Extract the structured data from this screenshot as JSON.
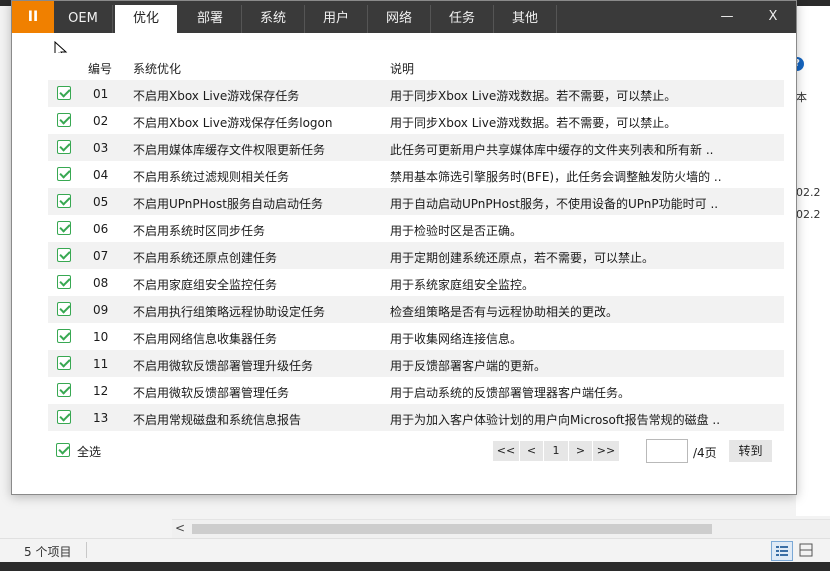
{
  "app": {
    "menu_glyph": "II",
    "tabs": [
      "OEM",
      "优化",
      "部署",
      "系统",
      "用户",
      "网络",
      "任务",
      "其他"
    ],
    "active_tab": "优化",
    "window_buttons": {
      "minimize": "—",
      "maximize": "☐",
      "close": "X"
    }
  },
  "table": {
    "headers": {
      "number": "编号",
      "name": "系统优化",
      "description": "说明"
    },
    "rows": [
      {
        "number": "01",
        "name": "不启用Xbox Live游戏保存任务",
        "description": "用于同步Xbox Live游戏数据。若不需要，可以禁止。"
      },
      {
        "number": "02",
        "name": "不启用Xbox Live游戏保存任务logon",
        "description": "用于同步Xbox Live游戏数据。若不需要，可以禁止。"
      },
      {
        "number": "03",
        "name": "不启用媒体库缓存文件权限更新任务",
        "description": "此任务可更新用户共享媒体库中缓存的文件夹列表和所有新 .."
      },
      {
        "number": "04",
        "name": "不启用系统过滤规则相关任务",
        "description": "禁用基本筛选引擎服务时(BFE)，此任务会调整触发防火墙的 .."
      },
      {
        "number": "05",
        "name": "不启用UPnPHost服务自动启动任务",
        "description": "用于自动启动UPnPHost服务，不使用设备的UPnP功能时可 .."
      },
      {
        "number": "06",
        "name": "不启用系统时区同步任务",
        "description": "用于检验时区是否正确。"
      },
      {
        "number": "07",
        "name": "不启用系统还原点创建任务",
        "description": "用于定期创建系统还原点，若不需要，可以禁止。"
      },
      {
        "number": "08",
        "name": "不启用家庭组安全监控任务",
        "description": "用于系统家庭组安全监控。"
      },
      {
        "number": "09",
        "name": "不启用执行组策略远程协助设定任务",
        "description": "检查组策略是否有与远程协助相关的更改。"
      },
      {
        "number": "10",
        "name": "不启用网络信息收集器任务",
        "description": "用于收集网络连接信息。"
      },
      {
        "number": "11",
        "name": "不启用微软反馈部署管理升级任务",
        "description": "用于反馈部署客户端的更新。"
      },
      {
        "number": "12",
        "name": "不启用微软反馈部署管理任务",
        "description": "用于启动系统的反馈部署管理器客户端任务。"
      },
      {
        "number": "13",
        "name": "不启用常规磁盘和系统信息报告",
        "description": "用于为加入客户体验计划的用户向Microsoft报告常规的磁盘 .."
      }
    ]
  },
  "footer": {
    "select_all": "全选",
    "pager": {
      "first": "<<",
      "prev": "<",
      "current": "1",
      "next": ">",
      "last": ">>",
      "page_input": "",
      "total": "/4页",
      "go": "转到"
    }
  },
  "background": {
    "help_glyph": "?",
    "side_texts": [
      "本",
      "02.2",
      "02.2"
    ],
    "hscroll_left": "<",
    "status_count": "5 个项目"
  },
  "colors": {
    "accent_orange": "#f08000",
    "titlebar": "#3a3a3a",
    "check_green": "#38a852",
    "row_stripe": "#f2f2f2"
  }
}
